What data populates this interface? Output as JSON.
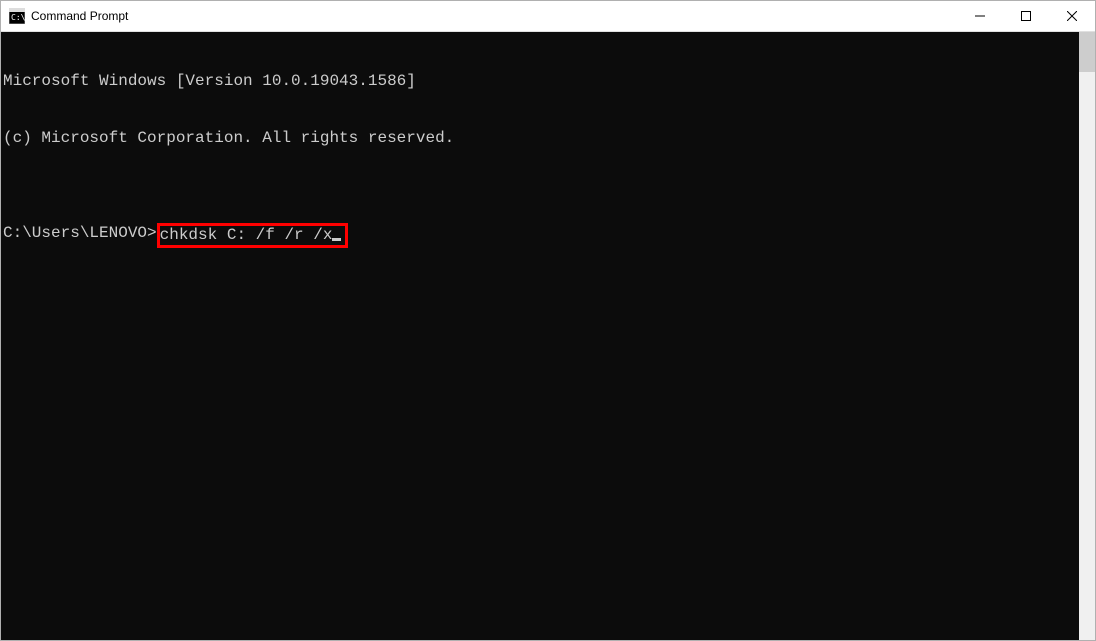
{
  "window": {
    "title": "Command Prompt"
  },
  "terminal": {
    "line1": "Microsoft Windows [Version 10.0.19043.1586]",
    "line2": "(c) Microsoft Corporation. All rights reserved.",
    "blank": "",
    "prompt": "C:\\Users\\LENOVO>",
    "command": "chkdsk C: /f /r /x"
  },
  "highlight": {
    "color": "#ff0000"
  }
}
